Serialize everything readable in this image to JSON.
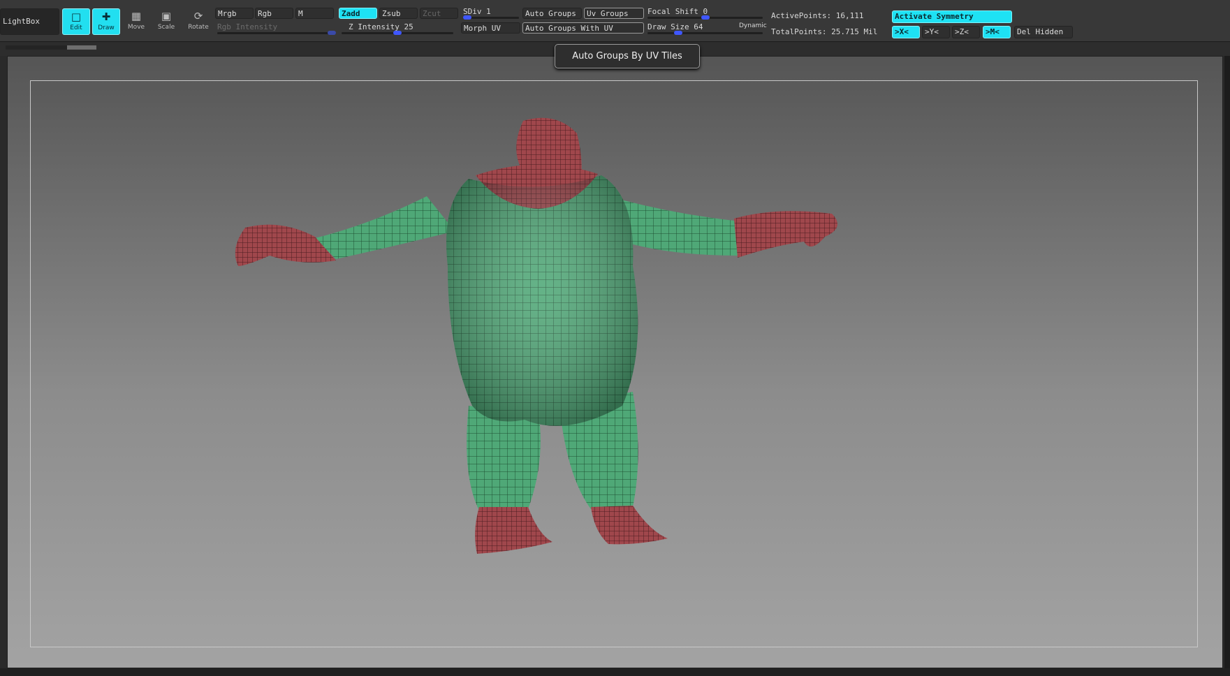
{
  "lightbox": {
    "label": "LightBox"
  },
  "tools": [
    {
      "label": "Edit",
      "icon": "edit-icon",
      "active": true
    },
    {
      "label": "Draw",
      "icon": "draw-icon",
      "active": true
    },
    {
      "label": "Move",
      "icon": "move-icon",
      "active": false
    },
    {
      "label": "Scale",
      "icon": "scale-icon",
      "active": false
    },
    {
      "label": "Rotate",
      "icon": "rotate-icon",
      "active": false
    }
  ],
  "color_modes": {
    "mrgb": "Mrgb",
    "rgb": "Rgb",
    "m": "M",
    "rgb_intensity": "Rgb Intensity"
  },
  "depth_modes": {
    "zadd": "Zadd",
    "zsub": "Zsub",
    "zcut": "Zcut",
    "z_intensity_label": "Z Intensity",
    "z_intensity_value": "25",
    "z_intensity_level": 0.25
  },
  "geometry": {
    "sdiv_label": "SDiv",
    "sdiv_value": "1",
    "morph_uv": "Morph UV"
  },
  "polygroups": {
    "auto_groups": "Auto Groups",
    "uv_groups": "Uv Groups",
    "auto_groups_with_uv": "Auto Groups With UV"
  },
  "draw": {
    "focal_shift_label": "Focal Shift",
    "focal_shift_value": "0",
    "draw_size_label": "Draw Size",
    "draw_size_value": "64",
    "dynamic": "Dynamic"
  },
  "stats": {
    "active_points": "ActivePoints: 16,111",
    "total_points": "TotalPoints: 25.715 Mil"
  },
  "symmetry": {
    "activate": "Activate Symmetry",
    "x": ">X<",
    "y": ">Y<",
    "z": ">Z<",
    "m": ">M<",
    "del_hidden": "Del Hidden"
  },
  "tooltip": {
    "text": "Auto Groups By UV Tiles"
  },
  "colors": {
    "accent": "#1ee2f4",
    "uv_group_body": "#4fa877",
    "uv_group_extremities": "#a0474c",
    "viewport_top": "#555555",
    "viewport_bottom": "#a3a3a3"
  },
  "canvas": {
    "model": "ogre-mesh-with-uv-polygroups"
  }
}
